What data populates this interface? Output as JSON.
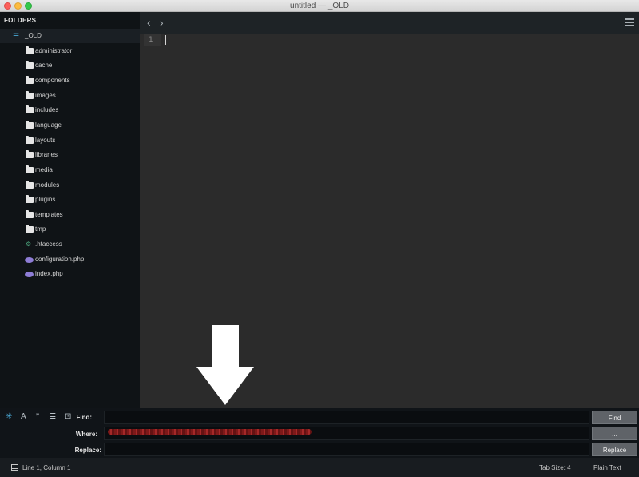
{
  "window": {
    "title": "untitled — _OLD"
  },
  "sidebar": {
    "header": "FOLDERS",
    "root": {
      "label": "_OLD",
      "icon": "project-root-icon"
    },
    "items": [
      {
        "label": "administrator",
        "icon": "folder-icon"
      },
      {
        "label": "cache",
        "icon": "folder-icon"
      },
      {
        "label": "components",
        "icon": "folder-icon"
      },
      {
        "label": "images",
        "icon": "folder-icon"
      },
      {
        "label": "includes",
        "icon": "folder-icon"
      },
      {
        "label": "language",
        "icon": "folder-icon"
      },
      {
        "label": "layouts",
        "icon": "folder-icon"
      },
      {
        "label": "libraries",
        "icon": "folder-icon"
      },
      {
        "label": "media",
        "icon": "folder-icon"
      },
      {
        "label": "modules",
        "icon": "folder-icon"
      },
      {
        "label": "plugins",
        "icon": "folder-icon"
      },
      {
        "label": "templates",
        "icon": "folder-icon"
      },
      {
        "label": "tmp",
        "icon": "folder-icon"
      },
      {
        "label": ".htaccess",
        "icon": "gear-file-icon"
      },
      {
        "label": "configuration.php",
        "icon": "php-file-icon"
      },
      {
        "label": "index.php",
        "icon": "php-file-icon"
      }
    ]
  },
  "editor": {
    "nav_back": "‹",
    "nav_forward": "›",
    "line_numbers": [
      "1"
    ]
  },
  "find_panel": {
    "options": [
      {
        "name": "regex-toggle",
        "glyph": "✳",
        "active": true
      },
      {
        "name": "case-toggle",
        "glyph": "A",
        "active": false
      },
      {
        "name": "whole-word-toggle",
        "glyph": "”",
        "active": false
      },
      {
        "name": "in-selection-toggle",
        "glyph": "≣",
        "active": false
      },
      {
        "name": "wrap-toggle",
        "glyph": "⊡",
        "active": false
      }
    ],
    "find_label": "Find:",
    "where_label": "Where:",
    "replace_label": "Replace:",
    "find_button": "Find",
    "where_button": "...",
    "replace_button": "Replace"
  },
  "status_bar": {
    "position": "Line 1, Column 1",
    "tab_size": "Tab Size: 4",
    "syntax": "Plain Text"
  },
  "colors": {
    "accent": "#4aa9d6",
    "sidebar_bg": "#0f1316",
    "editor_bg": "#2b2b2b",
    "button_bg": "#5f6368",
    "redaction": "#b52b2b"
  }
}
